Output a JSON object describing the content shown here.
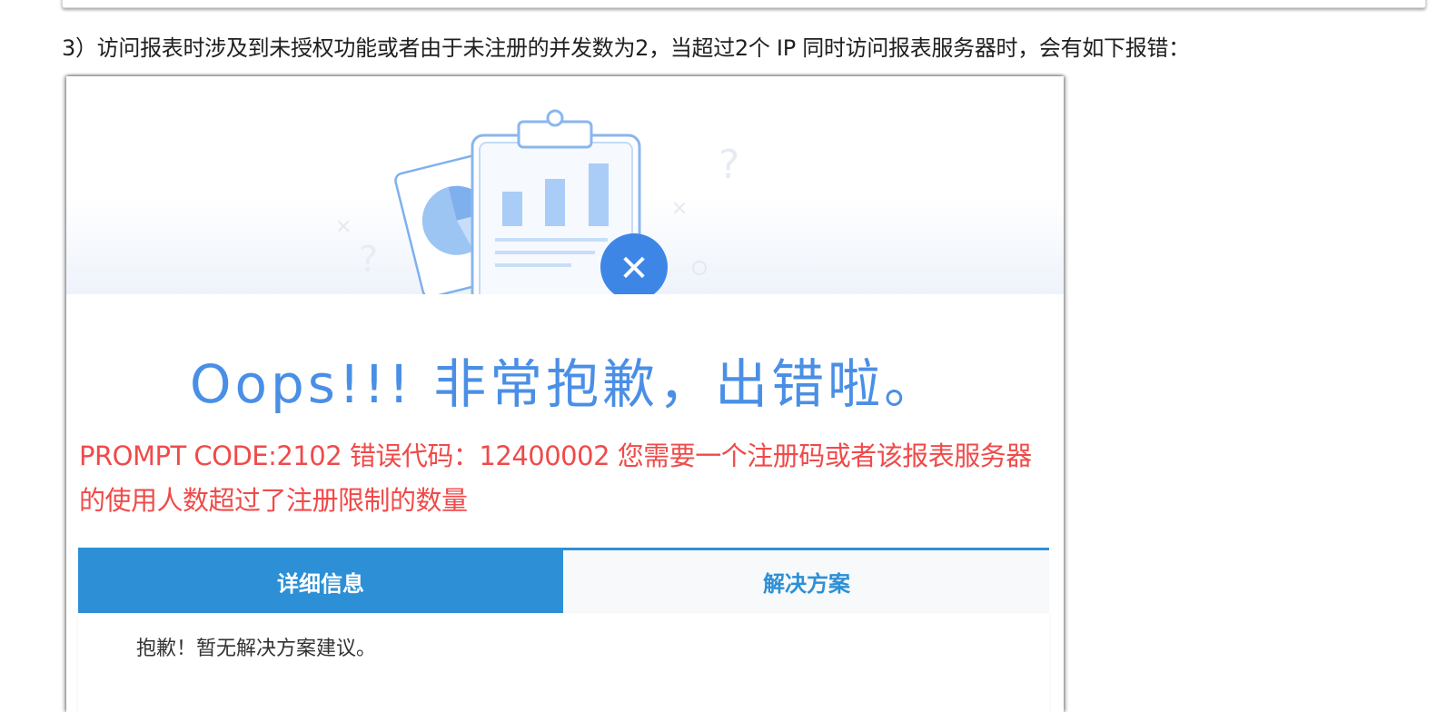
{
  "document": {
    "intro_text": "3）访问报表时涉及到未授权功能或者由于未注册的并发数为2，当超过2个 IP 同时访问报表服务器时，会有如下报错："
  },
  "error_page": {
    "illustration": {
      "icons": [
        "clipboard-icon",
        "pie-chart-icon",
        "bar-chart-icon",
        "error-x-icon",
        "question-mark-icon"
      ],
      "question_mark": "?",
      "close_mark": "✕"
    },
    "headline": "Oops!!! 非常抱歉，出错啦。",
    "prompt_message": "PROMPT CODE:2102 错误代码：12400002 您需要一个注册码或者该报表服务器的使用人数超过了注册限制的数量",
    "tabs": [
      {
        "label": "详细信息",
        "active": true
      },
      {
        "label": "解决方案",
        "active": false
      }
    ],
    "panel_text": "抱歉！暂无解决方案建议。",
    "colors": {
      "headline": "#4a8fe6",
      "error_text": "#f04a4a",
      "tab_active_bg": "#2d90d6",
      "tab_inactive_text": "#2d90d6"
    }
  }
}
